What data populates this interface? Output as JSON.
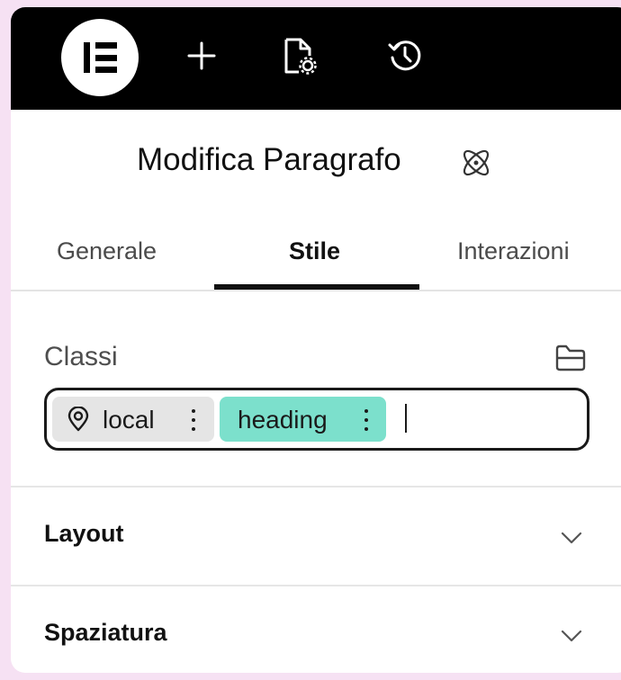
{
  "toolbar": {
    "logo_icon": "elementor-logo-icon",
    "add_icon": "plus-icon",
    "page_settings_icon": "page-settings-icon",
    "history_icon": "history-icon"
  },
  "panel": {
    "title": "Modifica Paragrafo",
    "title_icon": "atom-icon"
  },
  "tabs": [
    {
      "label": "Generale",
      "active": false
    },
    {
      "label": "Stile",
      "active": true
    },
    {
      "label": "Interazioni",
      "active": false
    }
  ],
  "classes": {
    "label": "Classi",
    "sync_icon": "sync-folder-icon",
    "chips": [
      {
        "label": "local",
        "icon": "location-pin-icon",
        "color": "#e5e5e5"
      },
      {
        "label": "heading",
        "icon": "",
        "color": "#7ce0cc"
      }
    ],
    "input_value": ""
  },
  "sections": [
    {
      "label": "Layout",
      "expanded": false
    },
    {
      "label": "Spaziatura",
      "expanded": false
    }
  ],
  "colors": {
    "topbar": "#000000",
    "accent_chip": "#7ce0cc",
    "page_background": "#f6e1f3"
  }
}
